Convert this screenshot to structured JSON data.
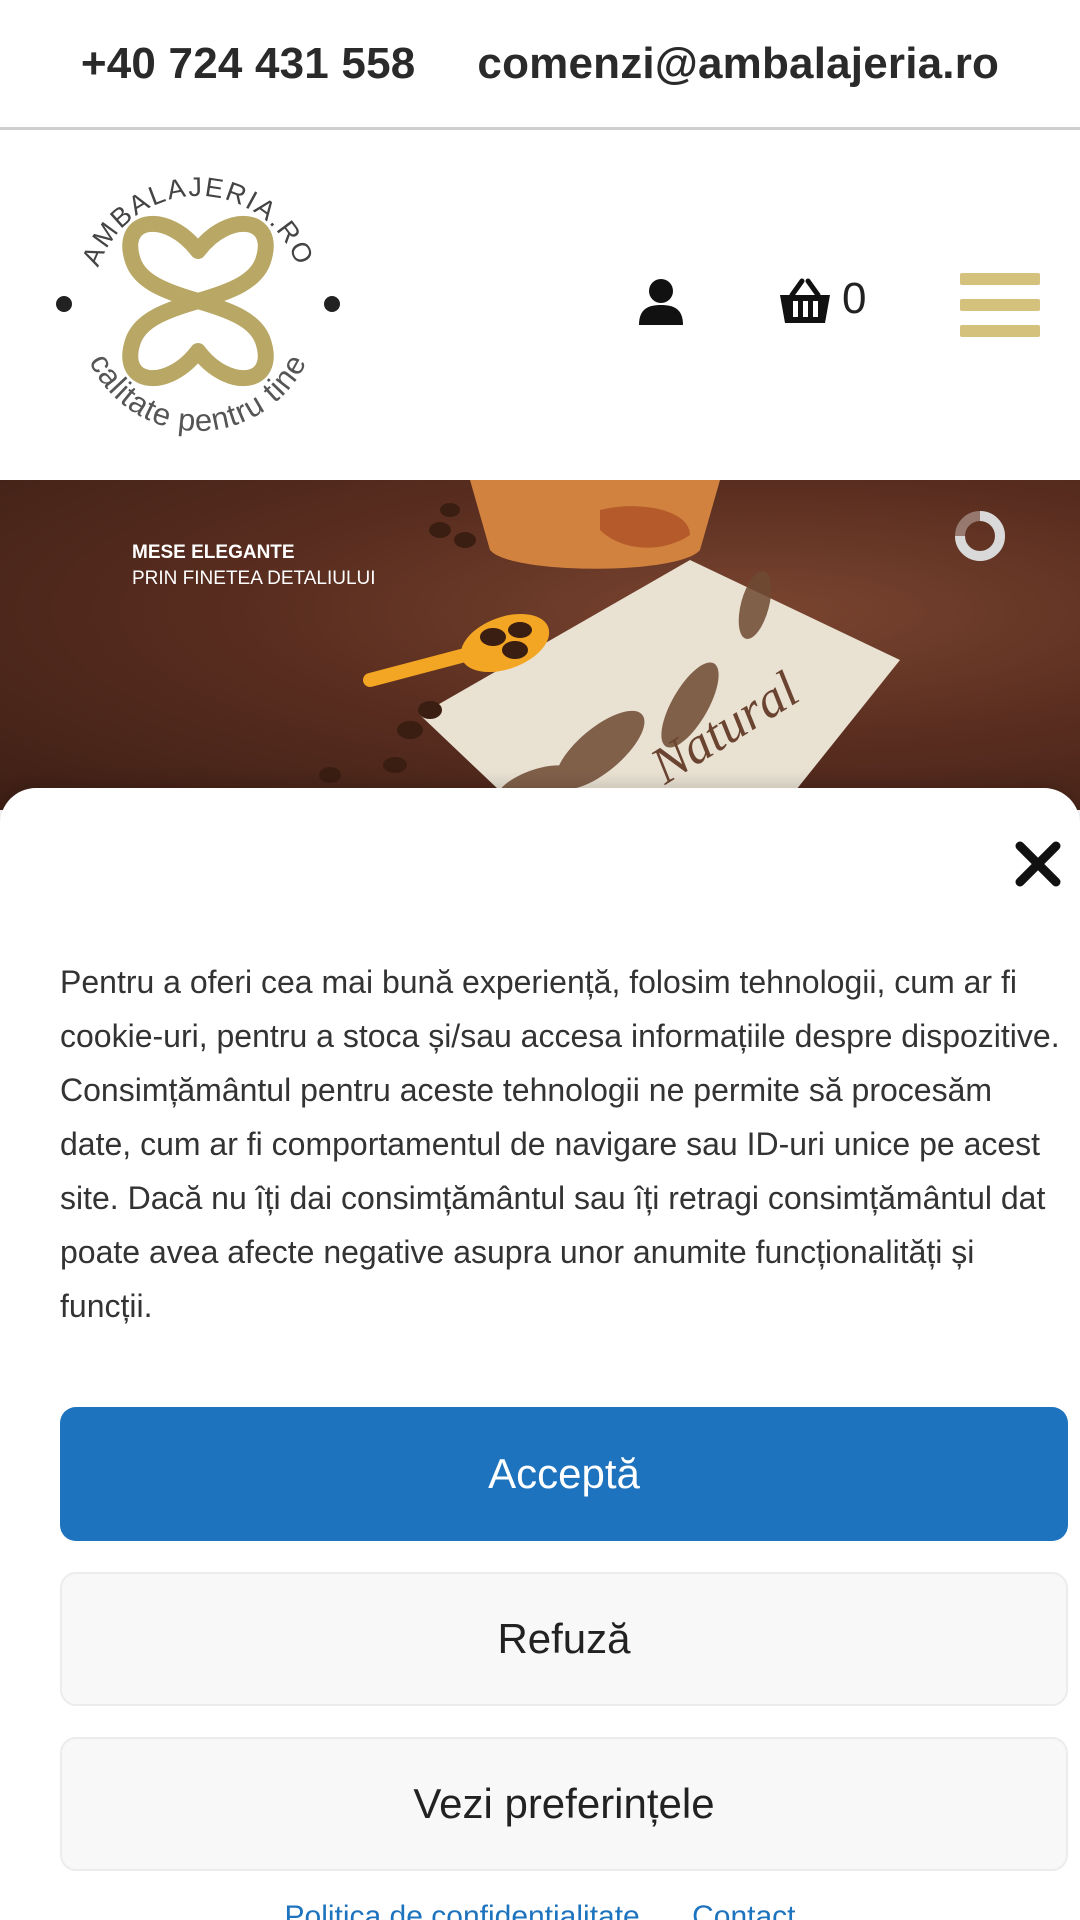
{
  "topbar": {
    "phone": "+40 724 431 558",
    "email": "comenzi@ambalajeria.ro"
  },
  "header": {
    "logo_text_top": "AMBALAJERIA.RO",
    "logo_text_bottom": "calitate pentru tine",
    "cart_count": "0",
    "icons": [
      "user-icon",
      "basket-icon",
      "hamburger-menu-icon"
    ],
    "accent_color": "#d4c27c"
  },
  "hero": {
    "line1": "MESE ELEGANTE",
    "line2": "PRIN FINETEA DETALIULUI",
    "napkin_text": "Natural"
  },
  "cookie": {
    "text": "Pentru a oferi cea mai bună experiență, folosim tehnologii, cum ar fi cookie-uri, pentru a stoca și/sau accesa informațiile despre dispozitive. Consimțământul pentru aceste tehnologii ne permite să procesăm date, cum ar fi comportamentul de navigare sau ID-uri unice pe acest site. Dacă nu îți dai consimțământul sau îți retragi consimțământul dat poate avea afecte negative asupra unor anumite funcționalități și funcții.",
    "accept_label": "Acceptă",
    "refuse_label": "Refuză",
    "prefs_label": "Vezi preferințele",
    "accept_color": "#1e73be"
  },
  "footer": {
    "links": [
      "Politica de confidentialitate",
      "Contact"
    ]
  }
}
